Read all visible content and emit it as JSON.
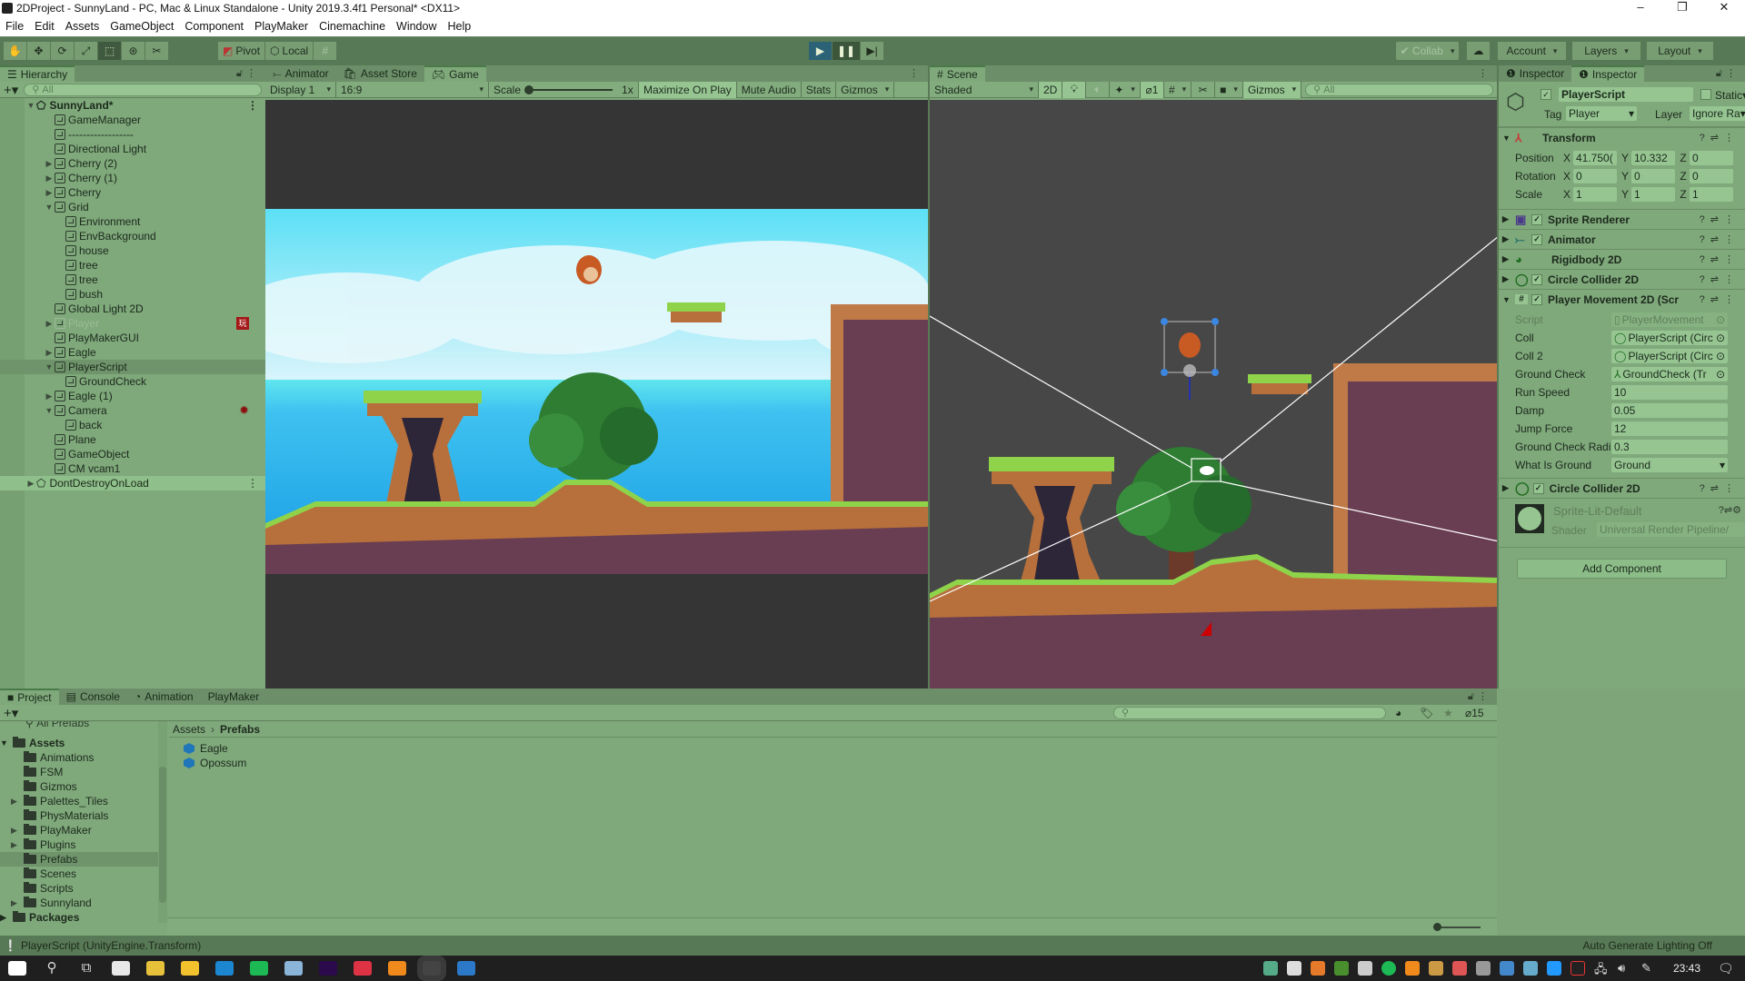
{
  "window": {
    "title": "2DProject - SunnyLand - PC, Mac & Linux Standalone - Unity 2019.3.4f1 Personal* <DX11>",
    "controls": [
      "–",
      "❐",
      "✕"
    ]
  },
  "menu": [
    "File",
    "Edit",
    "Assets",
    "GameObject",
    "Component",
    "PlayMaker",
    "Cinemachine",
    "Window",
    "Help"
  ],
  "toolbar": {
    "tools": [
      "hand-tool",
      "move-tool",
      "rotate-tool",
      "scale-tool",
      "rect-tool",
      "transform-tool",
      "custom-tool"
    ],
    "pivot_label": "Pivot",
    "local_label": "Local",
    "collab_label": "Collab",
    "account_label": "Account",
    "layers_label": "Layers",
    "layout_label": "Layout",
    "play_state": "playing"
  },
  "hierarchy": {
    "tab_label": "Hierarchy",
    "search_placeholder": "All",
    "scene_name": "SunnyLand*",
    "items": [
      {
        "label": "GameManager",
        "depth": 1,
        "arrow": ""
      },
      {
        "label": "------------------",
        "depth": 1,
        "arrow": ""
      },
      {
        "label": "Directional Light",
        "depth": 1,
        "arrow": ""
      },
      {
        "label": "Cherry (2)",
        "depth": 1,
        "arrow": "▶"
      },
      {
        "label": "Cherry (1)",
        "depth": 1,
        "arrow": "▶"
      },
      {
        "label": "Cherry",
        "depth": 1,
        "arrow": "▶"
      },
      {
        "label": "Grid",
        "depth": 1,
        "arrow": "▼"
      },
      {
        "label": "Environment",
        "depth": 2,
        "arrow": ""
      },
      {
        "label": "EnvBackground",
        "depth": 2,
        "arrow": ""
      },
      {
        "label": "house",
        "depth": 2,
        "arrow": ""
      },
      {
        "label": "tree",
        "depth": 2,
        "arrow": ""
      },
      {
        "label": "tree",
        "depth": 2,
        "arrow": ""
      },
      {
        "label": "bush",
        "depth": 2,
        "arrow": ""
      },
      {
        "label": "Global Light 2D",
        "depth": 1,
        "arrow": ""
      },
      {
        "label": "Player",
        "depth": 1,
        "arrow": "▶",
        "disabled": true,
        "badge": "playmaker"
      },
      {
        "label": "PlayMakerGUI",
        "depth": 1,
        "arrow": ""
      },
      {
        "label": "Eagle",
        "depth": 1,
        "arrow": "▶"
      },
      {
        "label": "PlayerScript",
        "depth": 1,
        "arrow": "▼",
        "selected": true
      },
      {
        "label": "GroundCheck",
        "depth": 2,
        "arrow": ""
      },
      {
        "label": "Eagle (1)",
        "depth": 1,
        "arrow": "▶"
      },
      {
        "label": "Camera",
        "depth": 1,
        "arrow": "▼",
        "badge": "cinemachine"
      },
      {
        "label": "back",
        "depth": 2,
        "arrow": ""
      },
      {
        "label": "Plane",
        "depth": 1,
        "arrow": ""
      },
      {
        "label": "GameObject",
        "depth": 1,
        "arrow": ""
      },
      {
        "label": "CM vcam1",
        "depth": 1,
        "arrow": ""
      }
    ],
    "dont_destroy": "DontDestroyOnLoad"
  },
  "game": {
    "tabs": [
      "Animator",
      "Asset Store",
      "Game"
    ],
    "active_tab": "Game",
    "display": "Display 1",
    "aspect": "16:9",
    "scale_label": "Scale",
    "scale_value": "1x",
    "maximize": "Maximize On Play",
    "mute": "Mute Audio",
    "stats": "Stats",
    "gizmos": "Gizmos"
  },
  "scene": {
    "tab_label": "Scene",
    "shading": "Shaded",
    "mode_2d": "2D",
    "hidden_count": "1",
    "gizmos": "Gizmos",
    "search_placeholder": "All"
  },
  "inspector": {
    "tabs": [
      "Inspector",
      "Inspector"
    ],
    "object_name": "PlayerScript",
    "static_label": "Static",
    "tag_label": "Tag",
    "tag_value": "Player",
    "layer_label": "Layer",
    "layer_value": "Ignore Ra",
    "transform": {
      "title": "Transform",
      "rows": [
        {
          "label": "Position",
          "x": "41.750(",
          "y": "10.332",
          "z": "0"
        },
        {
          "label": "Rotation",
          "x": "0",
          "y": "0",
          "z": "0"
        },
        {
          "label": "Scale",
          "x": "1",
          "y": "1",
          "z": "1"
        }
      ]
    },
    "components": [
      {
        "name": "Sprite Renderer",
        "icon": "sprite-renderer-icon",
        "checkbox": true
      },
      {
        "name": "Animator",
        "icon": "animator-icon",
        "checkbox": true
      },
      {
        "name": "Rigidbody 2D",
        "icon": "rigidbody-icon",
        "checkbox": false
      },
      {
        "name": "Circle Collider 2D",
        "icon": "circle-collider-icon",
        "checkbox": true
      }
    ],
    "movement": {
      "title": "Player Movement 2D (Scr",
      "fields": [
        {
          "label": "Script",
          "value": "PlayerMovement",
          "kind": "script"
        },
        {
          "label": "Coll",
          "value": "PlayerScript (Circ",
          "kind": "ref"
        },
        {
          "label": "Coll 2",
          "value": "PlayerScript (Circ",
          "kind": "ref"
        },
        {
          "label": "Ground Check",
          "value": "GroundCheck (Tr",
          "kind": "ref"
        },
        {
          "label": "Run Speed",
          "value": "10",
          "kind": "num"
        },
        {
          "label": "Damp",
          "value": "0.05",
          "kind": "num"
        },
        {
          "label": "Jump Force",
          "value": "12",
          "kind": "num"
        },
        {
          "label": "Ground Check Radius",
          "value": "0.3",
          "kind": "num"
        },
        {
          "label": "What Is Ground",
          "value": "Ground",
          "kind": "enum"
        }
      ]
    },
    "collider2": "Circle Collider 2D",
    "material": {
      "name": "Sprite-Lit-Default",
      "shader_label": "Shader",
      "shader_value": "Universal Render Pipeline/"
    },
    "add_component": "Add Component"
  },
  "project": {
    "tabs": [
      "Project",
      "Console",
      "Animation",
      "PlayMaker"
    ],
    "active_tab": "Project",
    "favorites_item": "All Prefabs",
    "root": "Assets",
    "folders": [
      {
        "label": "Animations",
        "arrow": ""
      },
      {
        "label": "FSM",
        "arrow": ""
      },
      {
        "label": "Gizmos",
        "arrow": ""
      },
      {
        "label": "Palettes_Tiles",
        "arrow": "▶"
      },
      {
        "label": "PhysMaterials",
        "arrow": ""
      },
      {
        "label": "PlayMaker",
        "arrow": "▶"
      },
      {
        "label": "Plugins",
        "arrow": "▶"
      },
      {
        "label": "Prefabs",
        "arrow": "",
        "selected": true
      },
      {
        "label": "Scenes",
        "arrow": ""
      },
      {
        "label": "Scripts",
        "arrow": ""
      },
      {
        "label": "Sunnyland",
        "arrow": "▶"
      }
    ],
    "packages": "Packages",
    "breadcrumb": [
      "Assets",
      "Prefabs"
    ],
    "files": [
      "Eagle",
      "Opossum"
    ],
    "hidden_count": "15"
  },
  "status": {
    "message": "PlayerScript (UnityEngine.Transform)",
    "lighting": "Auto Generate Lighting Off"
  },
  "taskbar": {
    "clock": "23:43",
    "apps": [
      "start",
      "search",
      "task-view",
      "store",
      "chrome",
      "file-explorer",
      "edge",
      "spotify",
      "notepad",
      "premiere",
      "chrome-alt",
      "vlc",
      "unity",
      "photos"
    ]
  }
}
